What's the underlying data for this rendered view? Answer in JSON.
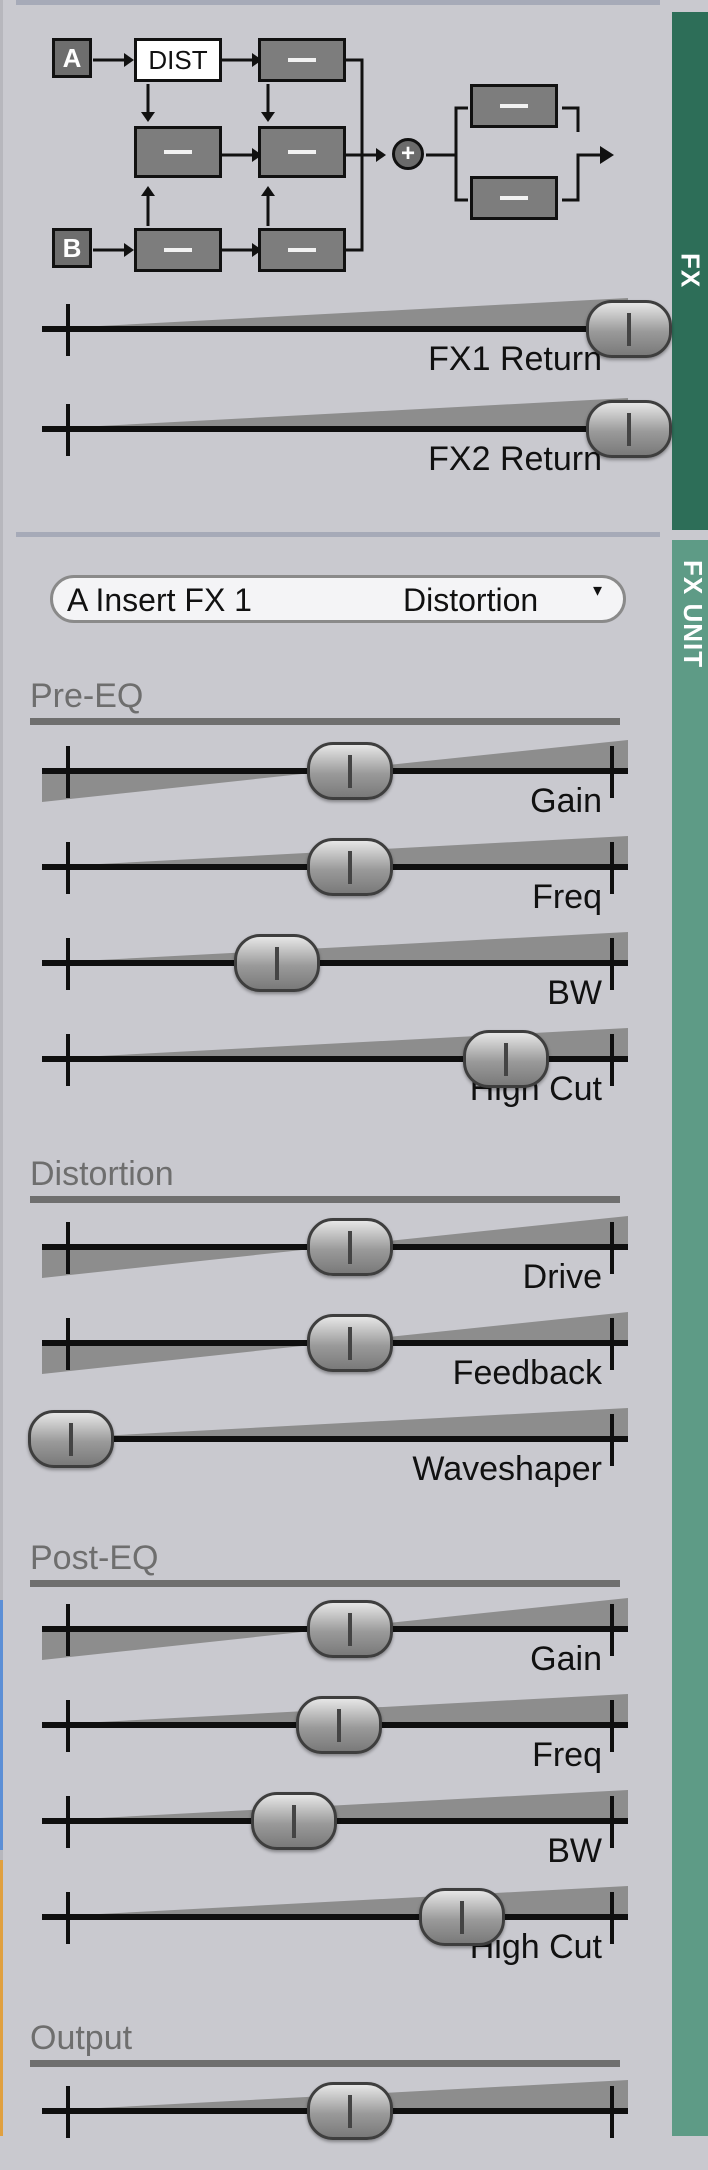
{
  "tabs": {
    "fx": {
      "label": "FX",
      "color": "#2d6e58"
    },
    "fx_unit": {
      "label": "FX UNIT",
      "color": "#5e9b86"
    }
  },
  "routing": {
    "input_a": "A",
    "input_b": "B",
    "dist_label": "DIST",
    "sum_symbol": "+"
  },
  "returns": [
    {
      "label": "FX1 Return",
      "value": 1.0
    },
    {
      "label": "FX2 Return",
      "value": 1.0
    }
  ],
  "fx_unit": {
    "slot": "A Insert FX 1",
    "type": "Distortion",
    "caret": "▾"
  },
  "sections": [
    {
      "title": "Pre-EQ",
      "sliders": [
        {
          "label": "Gain",
          "value": 0.5,
          "wedge": "gain"
        },
        {
          "label": "Freq",
          "value": 0.5,
          "wedge": "ramp"
        },
        {
          "label": "BW",
          "value": 0.37,
          "wedge": "ramp"
        },
        {
          "label": "High Cut",
          "value": 0.78,
          "wedge": "ramp"
        }
      ]
    },
    {
      "title": "Distortion",
      "sliders": [
        {
          "label": "Drive",
          "value": 0.5,
          "wedge": "gain"
        },
        {
          "label": "Feedback",
          "value": 0.5,
          "wedge": "gain"
        },
        {
          "label": "Waveshaper",
          "value": 0.0,
          "wedge": "ramp"
        }
      ]
    },
    {
      "title": "Post-EQ",
      "sliders": [
        {
          "label": "Gain",
          "value": 0.5,
          "wedge": "gain"
        },
        {
          "label": "Freq",
          "value": 0.48,
          "wedge": "ramp"
        },
        {
          "label": "BW",
          "value": 0.4,
          "wedge": "ramp"
        },
        {
          "label": "High Cut",
          "value": 0.7,
          "wedge": "ramp"
        }
      ]
    },
    {
      "title": "Output",
      "sliders": [
        {
          "label": "",
          "value": 0.5,
          "wedge": "ramp"
        }
      ]
    }
  ]
}
